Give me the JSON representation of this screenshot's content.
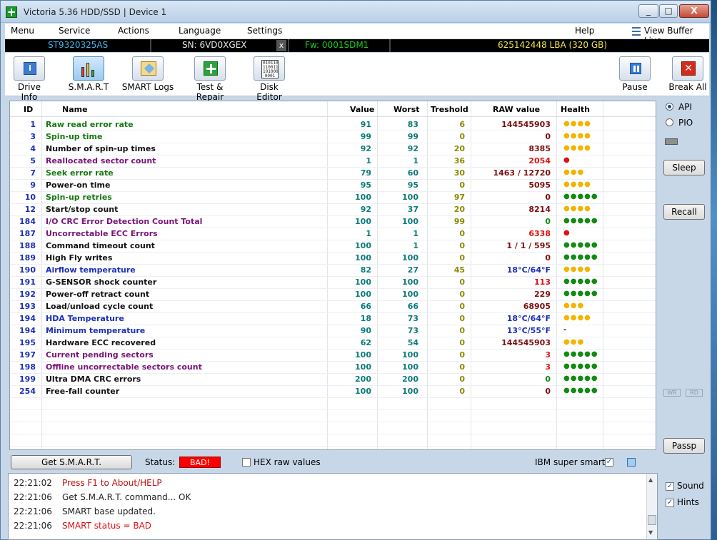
{
  "window": {
    "title": "Victoria 5.36 HDD/SSD | Device 1",
    "btn_min": "_",
    "btn_max": "□",
    "btn_close": "X"
  },
  "menu": {
    "items": [
      "Menu",
      "Service",
      "Actions",
      "Language",
      "Settings",
      "Help"
    ],
    "view_buffer": "View Buffer Live"
  },
  "info": {
    "model": "ST9320325AS",
    "serial": "SN: 6VD0XGEX",
    "close_glyph": "x",
    "firmware": "Fw: 0001SDM1",
    "capacity": "625142448 LBA (320 GB)"
  },
  "toolbar": {
    "drive_info": "Drive Info",
    "smart": "S.M.A.R.T",
    "smart_logs": "SMART Logs",
    "test_repair": "Test & Repair",
    "disk_editor": "Disk Editor",
    "pause": "Pause",
    "break_all": "Break All",
    "info_glyph": "i",
    "break_glyph": "✕",
    "hex_glyph": "010110 110011 101000 0001"
  },
  "table": {
    "headers": {
      "id": "ID",
      "name": "Name",
      "value": "Value",
      "worst": "Worst",
      "threshold": "Treshold",
      "raw": "RAW value",
      "health": "Health"
    },
    "rows": [
      {
        "id": "1",
        "name": "Raw read error rate",
        "color": "green",
        "value": "91",
        "worst": "83",
        "threshold": "6",
        "raw": "144545903",
        "raw_color": "#7b1010",
        "health": "●●●●",
        "health_color": "#f2b400"
      },
      {
        "id": "3",
        "name": "Spin-up time",
        "color": "green",
        "value": "99",
        "worst": "99",
        "threshold": "0",
        "raw": "0",
        "raw_color": "#7b1010",
        "health": "●●●●",
        "health_color": "#f2b400"
      },
      {
        "id": "4",
        "name": "Number of spin-up times",
        "color": "black",
        "value": "92",
        "worst": "92",
        "threshold": "20",
        "raw": "8385",
        "raw_color": "#7b1010",
        "health": "●●●●",
        "health_color": "#f2b400"
      },
      {
        "id": "5",
        "name": "Reallocated sector count",
        "color": "purple",
        "value": "1",
        "worst": "1",
        "threshold": "36",
        "raw": "2054",
        "raw_color": "#e01010",
        "health": "●",
        "health_color": "#e01010"
      },
      {
        "id": "7",
        "name": "Seek error rate",
        "color": "green",
        "value": "79",
        "worst": "60",
        "threshold": "30",
        "raw": "1463 / 12720",
        "raw_color": "#7b1010",
        "health": "●●●",
        "health_color": "#f2b400"
      },
      {
        "id": "9",
        "name": "Power-on time",
        "color": "black",
        "value": "95",
        "worst": "95",
        "threshold": "0",
        "raw": "5095",
        "raw_color": "#7b1010",
        "health": "●●●●",
        "health_color": "#f2b400"
      },
      {
        "id": "10",
        "name": "Spin-up retries",
        "color": "green",
        "value": "100",
        "worst": "100",
        "threshold": "97",
        "raw": "0",
        "raw_color": "#7b1010",
        "health": "●●●●●",
        "health_color": "#138a13"
      },
      {
        "id": "12",
        "name": "Start/stop count",
        "color": "black",
        "value": "92",
        "worst": "37",
        "threshold": "20",
        "raw": "8214",
        "raw_color": "#7b1010",
        "health": "●●●●",
        "health_color": "#f2b400"
      },
      {
        "id": "184",
        "name": "I/O CRC Error Detection Count Total",
        "color": "purple",
        "value": "100",
        "worst": "100",
        "threshold": "99",
        "raw": "0",
        "raw_color": "#138a13",
        "health": "●●●●●",
        "health_color": "#138a13"
      },
      {
        "id": "187",
        "name": "Uncorrectable ECC Errors",
        "color": "purple",
        "value": "1",
        "worst": "1",
        "threshold": "0",
        "raw": "6338",
        "raw_color": "#e01010",
        "health": "●",
        "health_color": "#e01010"
      },
      {
        "id": "188",
        "name": "Command timeout count",
        "color": "black",
        "value": "100",
        "worst": "1",
        "threshold": "0",
        "raw": "1 / 1 / 595",
        "raw_color": "#7b1010",
        "health": "●●●●●",
        "health_color": "#138a13"
      },
      {
        "id": "189",
        "name": "High Fly writes",
        "color": "black",
        "value": "100",
        "worst": "100",
        "threshold": "0",
        "raw": "0",
        "raw_color": "#7b1010",
        "health": "●●●●●",
        "health_color": "#138a13"
      },
      {
        "id": "190",
        "name": "Airflow temperature",
        "color": "blue",
        "value": "82",
        "worst": "27",
        "threshold": "45",
        "raw": "18°C/64°F",
        "raw_color": "#1c2fb8",
        "health": "●●●●",
        "health_color": "#f2b400"
      },
      {
        "id": "191",
        "name": "G-SENSOR shock counter",
        "color": "black",
        "value": "100",
        "worst": "100",
        "threshold": "0",
        "raw": "113",
        "raw_color": "#e01010",
        "health": "●●●●●",
        "health_color": "#138a13"
      },
      {
        "id": "192",
        "name": "Power-off retract count",
        "color": "black",
        "value": "100",
        "worst": "100",
        "threshold": "0",
        "raw": "229",
        "raw_color": "#7b1010",
        "health": "●●●●●",
        "health_color": "#138a13"
      },
      {
        "id": "193",
        "name": "Load/unload cycle count",
        "color": "black",
        "value": "66",
        "worst": "66",
        "threshold": "0",
        "raw": "68905",
        "raw_color": "#7b1010",
        "health": "●●●",
        "health_color": "#f2b400"
      },
      {
        "id": "194",
        "name": "HDA Temperature",
        "color": "blue",
        "value": "18",
        "worst": "73",
        "threshold": "0",
        "raw": "18°C/64°F",
        "raw_color": "#1c2fb8",
        "health": "●●●●",
        "health_color": "#f2b400"
      },
      {
        "id": "194",
        "name": "Minimum temperature",
        "color": "blue",
        "value": "90",
        "worst": "73",
        "threshold": "0",
        "raw": "13°C/55°F",
        "raw_color": "#1c2fb8",
        "health": "-",
        "health_color": "#111111"
      },
      {
        "id": "195",
        "name": "Hardware ECC recovered",
        "color": "black",
        "value": "62",
        "worst": "54",
        "threshold": "0",
        "raw": "144545903",
        "raw_color": "#7b1010",
        "health": "●●●",
        "health_color": "#f2b400"
      },
      {
        "id": "197",
        "name": "Current pending sectors",
        "color": "purple",
        "value": "100",
        "worst": "100",
        "threshold": "0",
        "raw": "3",
        "raw_color": "#e01010",
        "health": "●●●●●",
        "health_color": "#138a13"
      },
      {
        "id": "198",
        "name": "Offline uncorrectable sectors count",
        "color": "purple",
        "value": "100",
        "worst": "100",
        "threshold": "0",
        "raw": "3",
        "raw_color": "#e01010",
        "health": "●●●●●",
        "health_color": "#138a13"
      },
      {
        "id": "199",
        "name": "Ultra DMA CRC errors",
        "color": "black",
        "value": "200",
        "worst": "200",
        "threshold": "0",
        "raw": "0",
        "raw_color": "#138a13",
        "health": "●●●●●",
        "health_color": "#138a13"
      },
      {
        "id": "254",
        "name": "Free-fall counter",
        "color": "black",
        "value": "100",
        "worst": "100",
        "threshold": "0",
        "raw": "0",
        "raw_color": "#7b1010",
        "health": "●●●●●",
        "health_color": "#138a13"
      }
    ]
  },
  "right_panel": {
    "api": "API",
    "pio": "PIO",
    "api_selected": true,
    "sleep": "Sleep",
    "recall": "Recall",
    "wr": "WR",
    "rd": "RD",
    "passp": "Passp"
  },
  "bottom": {
    "get_smart": "Get S.M.A.R.T.",
    "status_label": "Status:",
    "status_value": "BAD!",
    "hex_label": "HEX raw values",
    "hex_checked": false,
    "ibm_label": "IBM super smart:",
    "ibm_checked": true,
    "check_glyph": "✓"
  },
  "log": [
    {
      "time": "22:21:02",
      "msg": "Press F1 to About/HELP",
      "color": "#c01010"
    },
    {
      "time": "22:21:06",
      "msg": "Get S.M.A.R.T. command... OK",
      "color": "#222222"
    },
    {
      "time": "22:21:06",
      "msg": "SMART base updated.",
      "color": "#222222"
    },
    {
      "time": "22:21:06",
      "msg": "SMART status = BAD",
      "color": "#e01010"
    }
  ],
  "side_options": {
    "sound": "Sound",
    "sound_checked": true,
    "hints": "Hints",
    "hints_checked": true
  }
}
